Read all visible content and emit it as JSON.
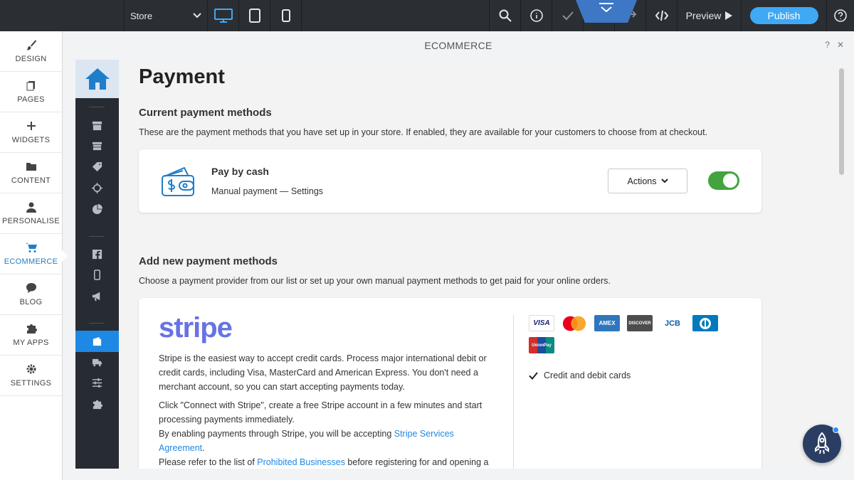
{
  "topbar": {
    "page_select": "Store",
    "preview_label": "Preview",
    "publish_label": "Publish"
  },
  "leftnav": {
    "items": [
      {
        "label": "DESIGN",
        "icon": "brush-icon"
      },
      {
        "label": "PAGES",
        "icon": "pages-icon"
      },
      {
        "label": "WIDGETS",
        "icon": "plus-icon"
      },
      {
        "label": "CONTENT",
        "icon": "folder-icon"
      },
      {
        "label": "PERSONALISE",
        "icon": "person-icon"
      },
      {
        "label": "ECOMMERCE",
        "icon": "cart-icon"
      },
      {
        "label": "BLOG",
        "icon": "chat-icon"
      },
      {
        "label": "MY APPS",
        "icon": "puzzle-icon"
      },
      {
        "label": "SETTINGS",
        "icon": "gear-icon"
      }
    ],
    "active": "ECOMMERCE"
  },
  "panel": {
    "title": "ECOMMERCE",
    "help": "?",
    "close": "✕"
  },
  "page": {
    "title": "Payment",
    "current": {
      "title": "Current payment methods",
      "desc": "These are the payment methods that you have set up in your store. If enabled, they are available for your customers to choose from at checkout.",
      "method_name": "Pay by cash",
      "method_sub": "Manual payment — Settings",
      "actions_label": "Actions",
      "enabled": true
    },
    "add": {
      "title": "Add new payment methods",
      "desc": "Choose a payment provider from our list or set up your own manual payment methods to get paid for your online orders."
    },
    "stripe": {
      "logo": "stripe",
      "p1": "Stripe is the easiest way to accept credit cards. Process major international debit or credit cards, including Visa, MasterCard and American Express. You don't need a merchant account, so you can start accepting payments today.",
      "p2_a": "Click \"Connect with Stripe\", create a free Stripe account in a few minutes and start processing payments immediately.",
      "p2_b": "By enabling payments through Stripe, you will be accepting ",
      "link1": "Stripe Services Agreement",
      "p2_c": ".",
      "p2_d": "Please refer to the list of ",
      "link2": "Prohibited Businesses",
      "p2_e": " before registering for and opening a Stripe account.",
      "cards": [
        "VISA",
        "mastercard",
        "AMEX",
        "DISCOVER",
        "JCB",
        "Diners",
        "UnionPay"
      ],
      "credit_label": "Credit and debit cards"
    }
  },
  "colors": {
    "accent": "#1e88e5",
    "publish": "#3fa9f5",
    "toggle_on": "#43a43f",
    "stripe": "#6772e5",
    "dark": "#2b2e33"
  }
}
